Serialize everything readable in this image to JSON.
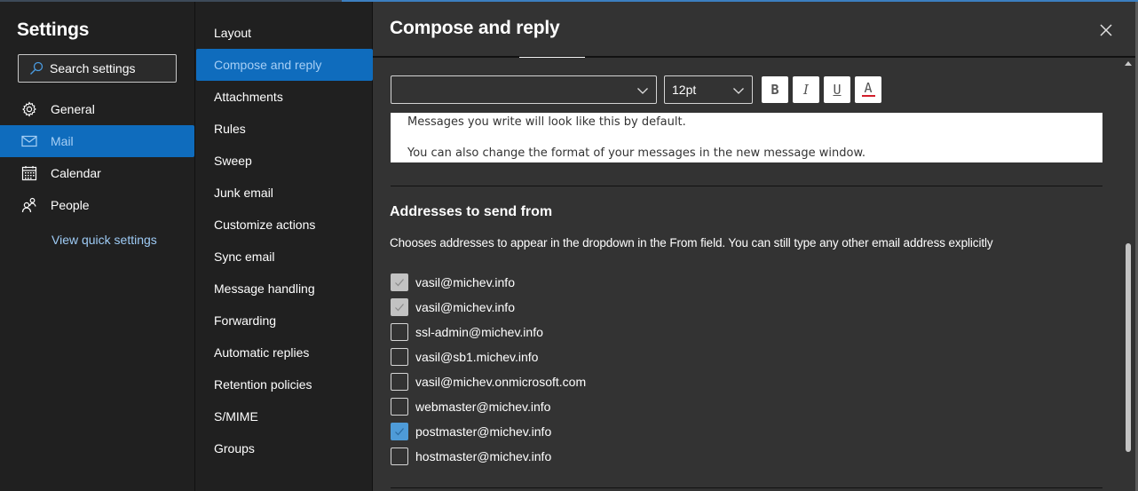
{
  "nav": {
    "title": "Settings",
    "search_placeholder": "Search settings",
    "items": [
      {
        "label": "General",
        "icon": "gear-icon",
        "active": false
      },
      {
        "label": "Mail",
        "icon": "mail-icon",
        "active": true
      },
      {
        "label": "Calendar",
        "icon": "calendar-icon",
        "active": false
      },
      {
        "label": "People",
        "icon": "people-icon",
        "active": false
      }
    ],
    "quick_settings_link": "View quick settings"
  },
  "subnav": {
    "items": [
      {
        "label": "Layout",
        "active": false
      },
      {
        "label": "Compose and reply",
        "active": true
      },
      {
        "label": "Attachments",
        "active": false
      },
      {
        "label": "Rules",
        "active": false
      },
      {
        "label": "Sweep",
        "active": false
      },
      {
        "label": "Junk email",
        "active": false
      },
      {
        "label": "Customize actions",
        "active": false
      },
      {
        "label": "Sync email",
        "active": false
      },
      {
        "label": "Message handling",
        "active": false
      },
      {
        "label": "Forwarding",
        "active": false
      },
      {
        "label": "Automatic replies",
        "active": false
      },
      {
        "label": "Retention policies",
        "active": false
      },
      {
        "label": "S/MIME",
        "active": false
      },
      {
        "label": "Groups",
        "active": false
      }
    ]
  },
  "content": {
    "title": "Compose and reply",
    "format": {
      "font_value": "",
      "size_value": "12pt",
      "bold_label": "B",
      "italic_label": "I",
      "underline_label": "U",
      "color_label": "A",
      "font_color": "#d21f2b"
    },
    "preview": {
      "line1": "Messages you write will look like this by default.",
      "line2": "You can also change the format of your messages in the new message window."
    },
    "addresses": {
      "title": "Addresses to send from",
      "description": "Chooses addresses to appear in the dropdown in the From field. You can still type any other email address explicitly",
      "items": [
        {
          "email": "vasil@michev.info",
          "state": "checked-disabled"
        },
        {
          "email": "vasil@michev.info",
          "state": "checked-disabled"
        },
        {
          "email": "ssl-admin@michev.info",
          "state": "unchecked"
        },
        {
          "email": "vasil@sb1.michev.info",
          "state": "unchecked"
        },
        {
          "email": "vasil@michev.onmicrosoft.com",
          "state": "unchecked"
        },
        {
          "email": "webmaster@michev.info",
          "state": "unchecked"
        },
        {
          "email": "postmaster@michev.info",
          "state": "checked"
        },
        {
          "email": "hostmaster@michev.info",
          "state": "unchecked"
        }
      ]
    }
  },
  "colors": {
    "accent": "#0f6cbd",
    "checkbox_checked": "#4e9bd8",
    "link": "#9ecbf5"
  }
}
